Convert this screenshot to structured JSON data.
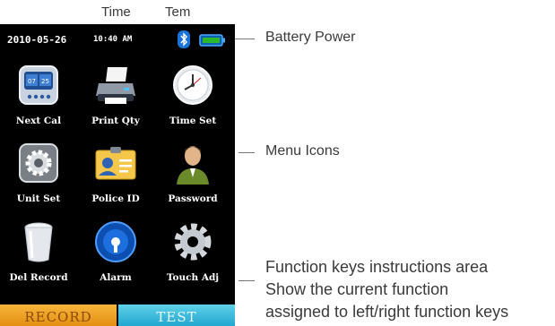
{
  "annotations": {
    "time": "Time",
    "tem": "Tem",
    "battery_power": "Battery Power",
    "menu_icons": "Menu Icons",
    "function_keys": [
      "Function keys instructions area",
      "Show the current function",
      "assigned to left/right function keys"
    ]
  },
  "status_bar": {
    "date": "2010-05-26",
    "time": "10:40 AM",
    "icons": [
      "bluetooth-icon",
      "battery-icon"
    ]
  },
  "menu": [
    {
      "label": "Next Cal",
      "icon": "calendar-icon"
    },
    {
      "label": "Print Qty",
      "icon": "printer-icon"
    },
    {
      "label": "Time Set",
      "icon": "clock-icon"
    },
    {
      "label": "Unit Set",
      "icon": "gear-box-icon"
    },
    {
      "label": "Police ID",
      "icon": "id-badge-icon"
    },
    {
      "label": "Password",
      "icon": "person-icon"
    },
    {
      "label": "Del Record",
      "icon": "trash-icon"
    },
    {
      "label": "Alarm",
      "icon": "alarm-icon"
    },
    {
      "label": "Touch Adj",
      "icon": "cog-icon"
    }
  ],
  "function_keys": {
    "left": "RECORD",
    "right": "TEST"
  },
  "colors": {
    "screen_bg": "#000000",
    "left_key": "#f0a224",
    "right_key": "#3fbfe0",
    "battery_fill": "#2db82d",
    "bluetooth": "#1a73d9"
  }
}
